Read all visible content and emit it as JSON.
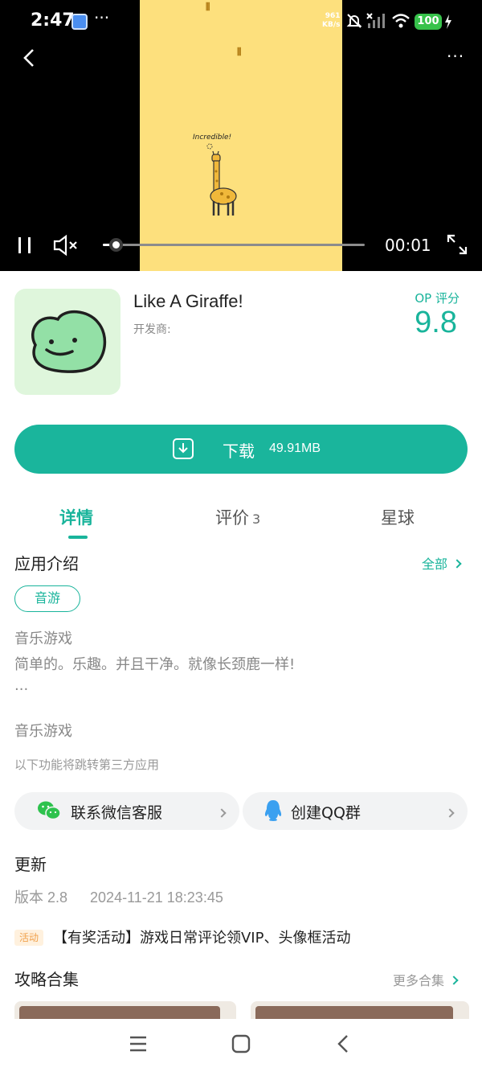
{
  "status_bar": {
    "time": "2:47",
    "more": "···",
    "net_speed_value": "961",
    "net_speed_unit": "KB/s",
    "battery": "100"
  },
  "video": {
    "overlay_text": "Incredible!",
    "more": "···",
    "current_time": "00:01",
    "progress_fraction": 0.04
  },
  "app": {
    "name": "Like A Giraffe!",
    "developer_label": "开发商:",
    "score_label": "OP 评分",
    "score": "9.8",
    "download_label": "下载",
    "download_size": "49.91MB"
  },
  "tabs": [
    {
      "label": "详情",
      "count": ""
    },
    {
      "label": "评价",
      "count": "3"
    },
    {
      "label": "星球",
      "count": ""
    }
  ],
  "intro": {
    "title": "应用介绍",
    "all_link": "全部",
    "tag": "音游",
    "line1": "音乐游戏",
    "line2": "简单的。乐趣。并且干净。就像长颈鹿一样!",
    "ellipsis": "...",
    "line3": "音乐游戏",
    "third_party_note": "以下功能将跳转第三方应用"
  },
  "contacts": {
    "wechat": "联系微信客服",
    "qq": "创建QQ群"
  },
  "update": {
    "title": "更新",
    "version": "版本 2.8",
    "datetime": "2024-11-21 18:23:45",
    "activity_badge": "活动",
    "activity_text": "【有奖活动】游戏日常评论领VIP、头像框活动"
  },
  "guides": {
    "title": "攻略合集",
    "more_link": "更多合集"
  },
  "colors": {
    "accent": "#19b49b",
    "video_bg": "#fde07d"
  }
}
